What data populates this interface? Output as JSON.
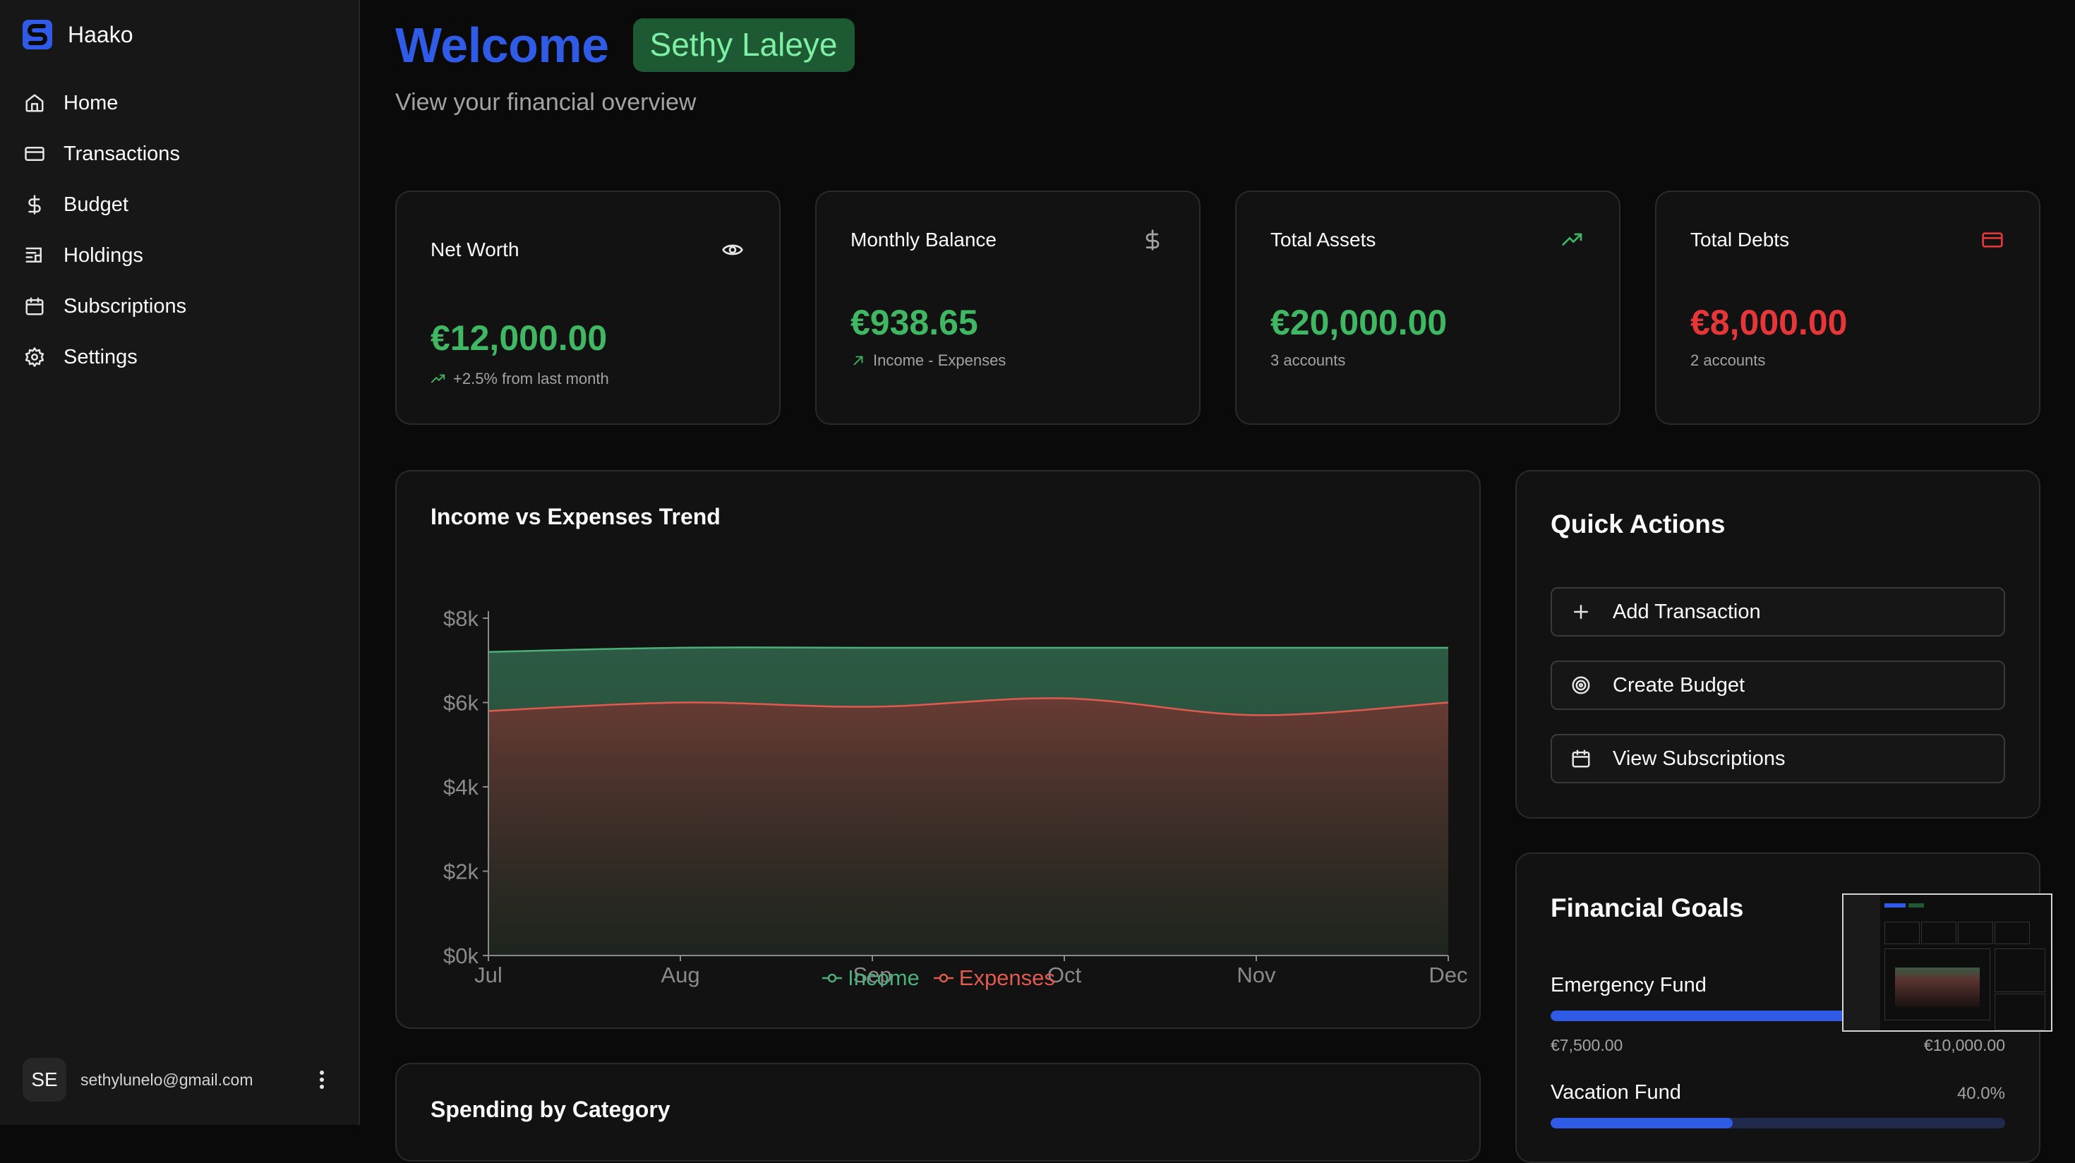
{
  "app": {
    "name": "Haako"
  },
  "nav": {
    "items": [
      {
        "label": "Home",
        "icon": "home-icon"
      },
      {
        "label": "Transactions",
        "icon": "credit-card-icon"
      },
      {
        "label": "Budget",
        "icon": "dollar-icon"
      },
      {
        "label": "Holdings",
        "icon": "holdings-icon"
      },
      {
        "label": "Subscriptions",
        "icon": "calendar-icon"
      },
      {
        "label": "Settings",
        "icon": "gear-icon"
      }
    ]
  },
  "user": {
    "initials": "SE",
    "email": "sethylunelo@gmail.com"
  },
  "header": {
    "welcome": "Welcome",
    "name": "Sethy Laleye",
    "subtitle": "View your financial overview"
  },
  "stats": [
    {
      "title": "Net Worth",
      "value": "€12,000.00",
      "sub": "+2.5% from last month",
      "icon": "eye-icon",
      "color": "#3fb763"
    },
    {
      "title": "Monthly Balance",
      "value": "€938.65",
      "sub": "Income - Expenses",
      "icon": "dollar-icon",
      "color": "#3fb763"
    },
    {
      "title": "Total Assets",
      "value": "€20,000.00",
      "sub": "3 accounts",
      "icon": "trending-up-icon",
      "color": "#3fb763"
    },
    {
      "title": "Total Debts",
      "value": "€8,000.00",
      "sub": "2 accounts",
      "icon": "credit-card-icon",
      "color": "#e5373a"
    }
  ],
  "trend": {
    "title": "Income vs Expenses Trend"
  },
  "chart_data": {
    "type": "area",
    "title": "Income vs Expenses Trend",
    "categories": [
      "Jul",
      "Aug",
      "Sep",
      "Oct",
      "Nov",
      "Dec"
    ],
    "series": [
      {
        "name": "Income",
        "color": "#4caf7a",
        "values": [
          7200,
          7300,
          7300,
          7300,
          7300,
          7300
        ]
      },
      {
        "name": "Expenses",
        "color": "#e05a4f",
        "values": [
          5800,
          6000,
          5900,
          6100,
          5700,
          6000
        ]
      }
    ],
    "y_ticks": [
      "$0k",
      "$2k",
      "$4k",
      "$6k",
      "$8k"
    ],
    "ylim": [
      0,
      8000
    ],
    "legend_position": "bottom"
  },
  "spending": {
    "title": "Spending by Category"
  },
  "quick_actions": {
    "title": "Quick Actions",
    "items": [
      {
        "label": "Add Transaction",
        "icon": "plus-icon"
      },
      {
        "label": "Create Budget",
        "icon": "target-icon"
      },
      {
        "label": "View Subscriptions",
        "icon": "calendar-icon"
      }
    ]
  },
  "goals": {
    "title": "Financial Goals",
    "items": [
      {
        "name": "Emergency Fund",
        "current": "€7,500.00",
        "target": "€10,000.00",
        "progress": 0.75
      },
      {
        "name": "Vacation Fund",
        "percent": "40.0%",
        "progress": 0.4
      }
    ]
  },
  "colors": {
    "accent_blue": "#2f5be6",
    "positive": "#3fb763",
    "negative": "#e5373a"
  }
}
